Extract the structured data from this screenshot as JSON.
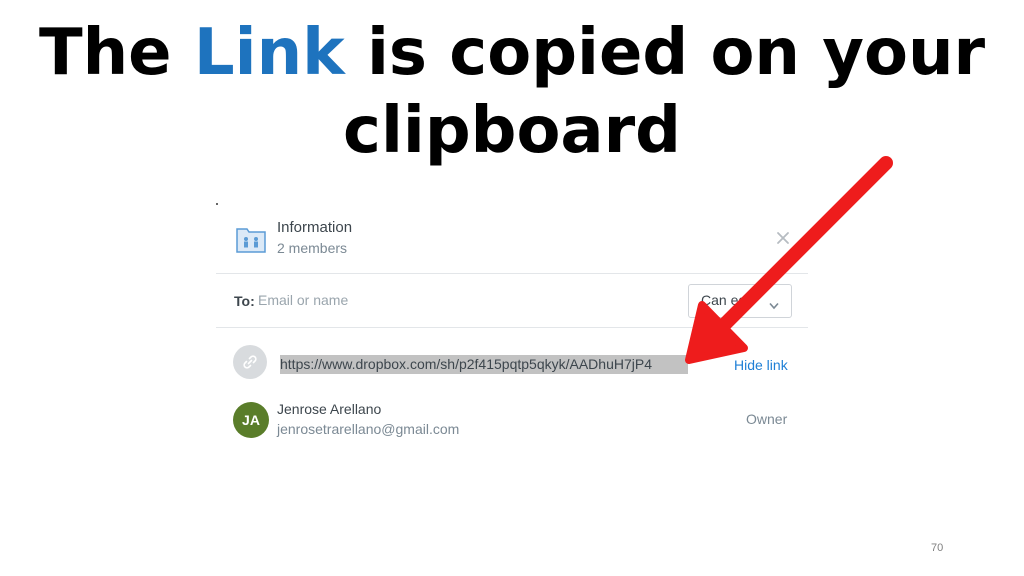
{
  "slide": {
    "title_before": "The ",
    "title_accent": "Link",
    "title_after": " is copied on your clipboard",
    "accent_color": "#1e73be",
    "page_number": "70"
  },
  "dialog": {
    "header": {
      "title": "Information",
      "subtitle": "2 members",
      "icon": "shared-folder-icon"
    },
    "to_row": {
      "label": "To:",
      "placeholder": "Email or name",
      "permission": "Can edit"
    },
    "link_row": {
      "icon": "link-icon",
      "url": "https://www.dropbox.com/sh/p2f415pqtp5qkyk/AADhuH7jP4",
      "action": "Hide link"
    },
    "members": [
      {
        "initials": "JA",
        "name": "Jenrose Arellano",
        "email": "jenrosetrarellano@gmail.com",
        "role": "Owner",
        "avatar_color": "#5a7d2a"
      }
    ]
  },
  "annotation": {
    "arrow_color": "#ee1c1c"
  }
}
